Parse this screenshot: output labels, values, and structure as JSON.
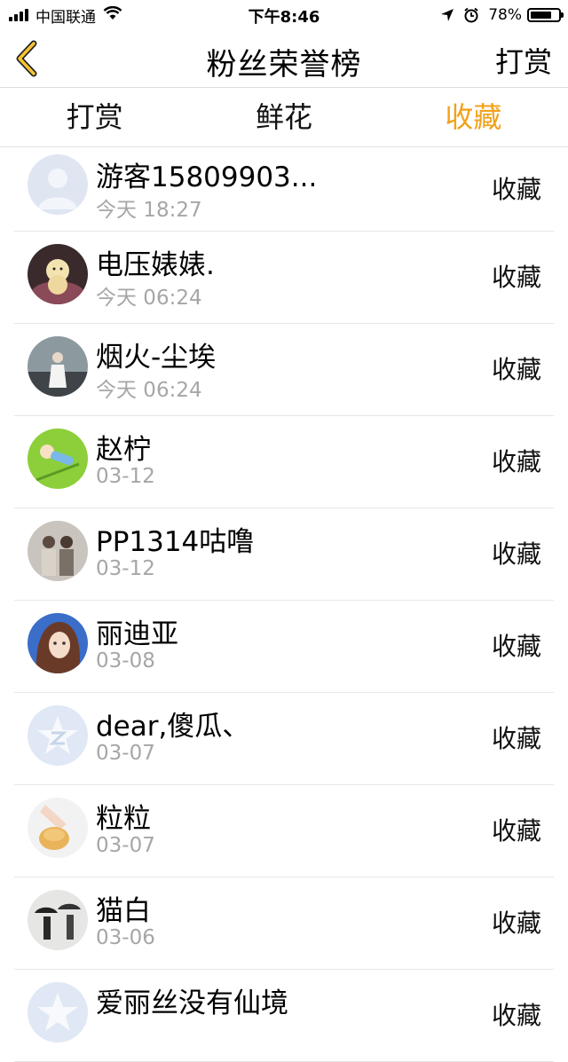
{
  "status_bar": {
    "carrier": "中国联通",
    "time": "下午8:46",
    "battery": "78%",
    "battery_level": 0.78
  },
  "nav": {
    "title": "粉丝荣誉榜",
    "right_button": "打赏",
    "back_icon": "chevron-left-icon",
    "accent_color": "#f0a21b"
  },
  "tabs": [
    {
      "label": "打赏",
      "active": false
    },
    {
      "label": "鲜花",
      "active": false
    },
    {
      "label": "收藏",
      "active": true
    }
  ],
  "fans": [
    {
      "name": "游客15809903...",
      "date": "今天 18:27",
      "action": "收藏",
      "avatar": "default-person-avatar"
    },
    {
      "name": "电压婊婊.",
      "date": "今天 06:24",
      "action": "收藏",
      "avatar": "chick-avatar"
    },
    {
      "name": "烟火-尘埃",
      "date": "今天 06:24",
      "action": "收藏",
      "avatar": "girl-photo-avatar"
    },
    {
      "name": "赵柠",
      "date": "03-12",
      "action": "收藏",
      "avatar": "cartoon-grass-avatar"
    },
    {
      "name": "PP1314咕噜",
      "date": "03-12",
      "action": "收藏",
      "avatar": "group-photo-avatar"
    },
    {
      "name": "丽迪亚",
      "date": "03-08",
      "action": "收藏",
      "avatar": "anime-girl-avatar"
    },
    {
      "name": "dear,傻瓜、",
      "date": "03-07",
      "action": "收藏",
      "avatar": "qzone-star-avatar"
    },
    {
      "name": "粒粒",
      "date": "03-07",
      "action": "收藏",
      "avatar": "hand-bread-avatar"
    },
    {
      "name": "猫白",
      "date": "03-06",
      "action": "收藏",
      "avatar": "umbrella-people-avatar"
    },
    {
      "name": "爱丽丝没有仙境",
      "date": "",
      "action": "收藏",
      "avatar": "qzone-star-avatar"
    }
  ]
}
